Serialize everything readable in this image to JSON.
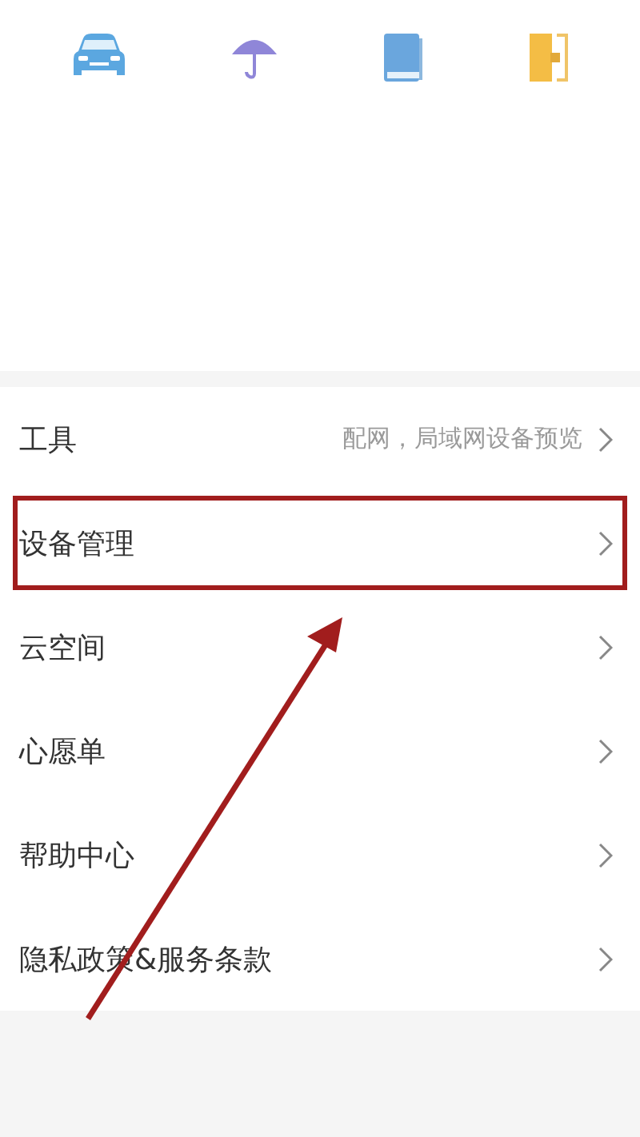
{
  "shortcuts": [
    {
      "kind": "car"
    },
    {
      "kind": "umbrella"
    },
    {
      "kind": "book"
    },
    {
      "kind": "door"
    }
  ],
  "menu": [
    {
      "label": "工具",
      "hint": "配网，局域网设备预览",
      "highlighted": false
    },
    {
      "label": "设备管理",
      "highlighted": true
    },
    {
      "label": "云空间",
      "highlighted": false
    },
    {
      "label": "心愿单",
      "highlighted": false
    },
    {
      "label": "帮助中心",
      "highlighted": false
    },
    {
      "label": "隐私政策&服务条款",
      "highlighted": false
    }
  ],
  "annotation": {
    "kind": "arrow"
  }
}
